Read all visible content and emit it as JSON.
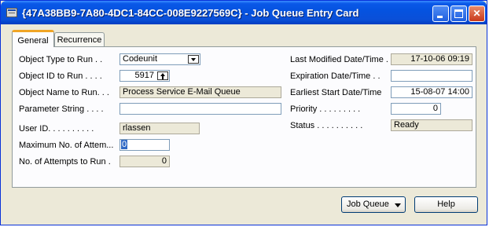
{
  "window": {
    "title": "{47A38BB9-7A80-4DC1-84CC-008E9227569C} - Job Queue Entry Card"
  },
  "tabs": [
    {
      "label": "General"
    },
    {
      "label": "Recurrence"
    }
  ],
  "left_fields": {
    "object_type": {
      "label": "Object Type to Run . .",
      "value": "Codeunit"
    },
    "object_id": {
      "label": "Object ID to Run . . . .",
      "value": "5917"
    },
    "object_name": {
      "label": "Object Name to Run. . .",
      "value": "Process Service E-Mail Queue"
    },
    "parameter_string": {
      "label": "Parameter String . . . .",
      "value": ""
    },
    "user_id": {
      "label": "User ID. . . . . . . . . .",
      "value": "rlassen"
    },
    "max_attempts": {
      "label": "Maximum No. of Attem...",
      "value": "0"
    },
    "attempts_to_run": {
      "label": "No. of Attempts to Run .",
      "value": "0"
    }
  },
  "right_fields": {
    "last_modified": {
      "label": "Last Modified Date/Time .",
      "value": "17-10-06 09:19"
    },
    "expiration": {
      "label": "Expiration Date/Time . .",
      "value": ""
    },
    "earliest_start": {
      "label": "Earliest Start Date/Time",
      "value": "15-08-07 14:00"
    },
    "priority": {
      "label": "Priority . . . . . . . . .",
      "value": "0"
    },
    "status": {
      "label": "Status . . . . . . . . . .",
      "value": "Ready"
    }
  },
  "buttons": {
    "job_queue": "Job Queue",
    "help": "Help"
  },
  "icons": [
    "app-window-icon",
    "minimize-icon",
    "maximize-icon",
    "close-icon",
    "dropdown-arrow-icon",
    "lookup-arrow-icon"
  ],
  "colors": {
    "titlebar": "#0553e0",
    "window_bg": "#ece9d8",
    "tab_highlight": "#f0a526",
    "selection": "#316ac5"
  }
}
